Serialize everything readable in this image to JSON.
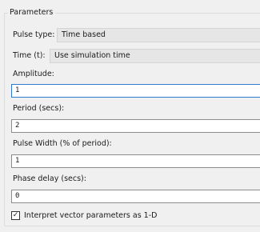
{
  "group": {
    "title": "Parameters"
  },
  "pulse_type": {
    "label": "Pulse type:",
    "value": "Time based"
  },
  "time": {
    "label": "Time (t):",
    "value": "Use simulation time"
  },
  "fields": [
    {
      "label": "Amplitude:",
      "value": "1"
    },
    {
      "label": "Period (secs):",
      "value": "2"
    },
    {
      "label": "Pulse Width (% of period):",
      "value": "1"
    },
    {
      "label": "Phase delay (secs):",
      "value": "0"
    }
  ],
  "interpret_vector": {
    "label": "Interpret vector parameters as 1-D",
    "checked": true,
    "mark": "✓"
  }
}
